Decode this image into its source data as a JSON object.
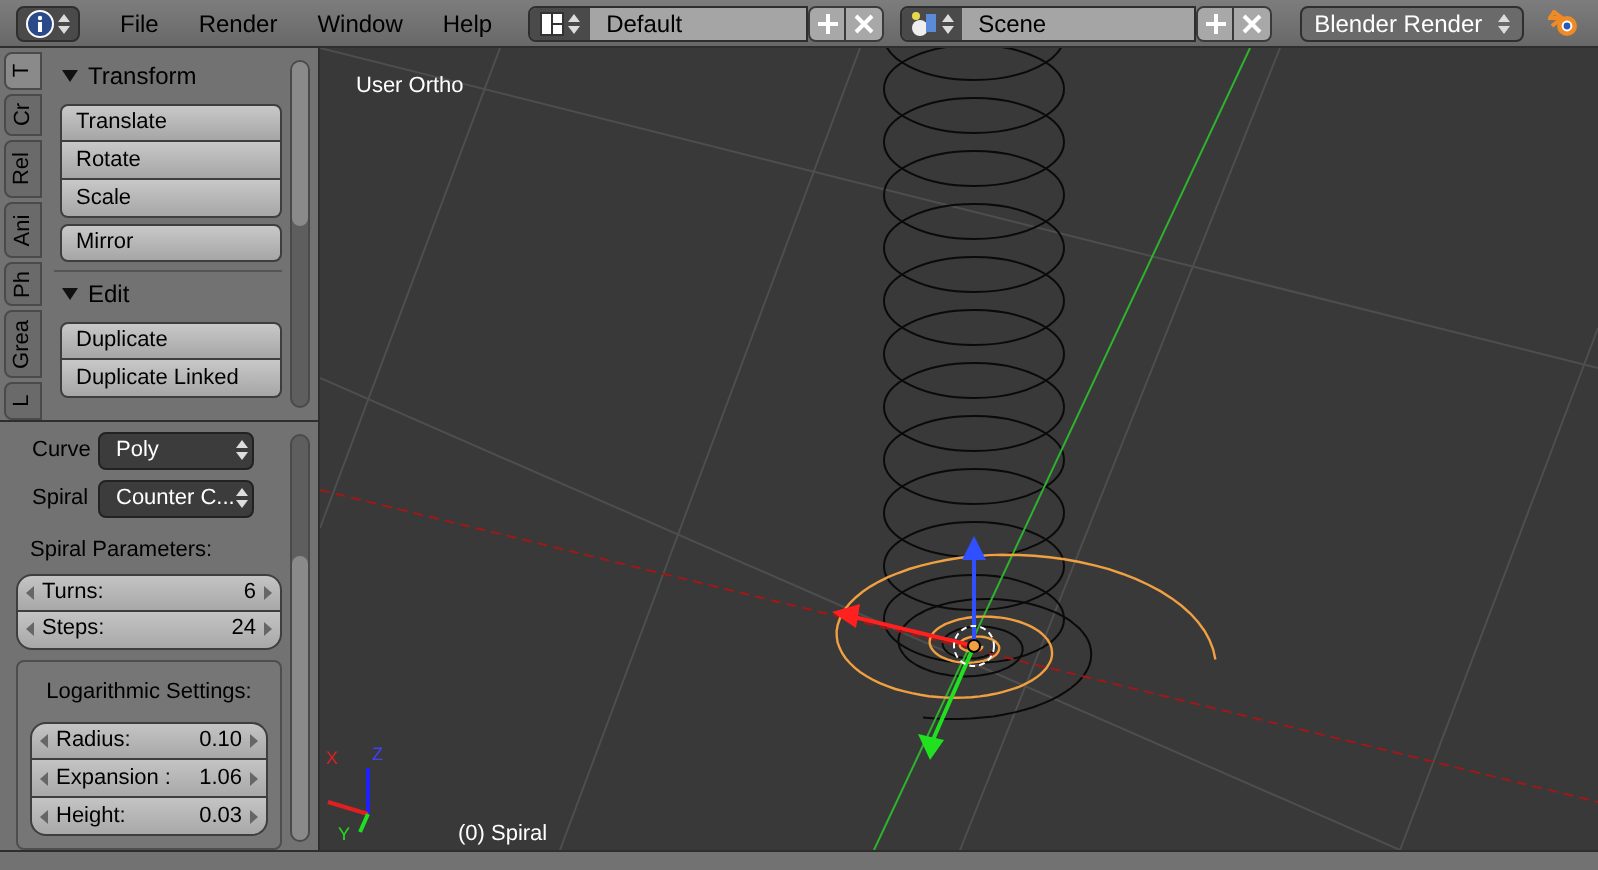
{
  "menu_bar": {
    "menus": [
      "File",
      "Render",
      "Window",
      "Help"
    ],
    "layout": "Default",
    "scene": "Scene",
    "render_engine": "Blender Render"
  },
  "tool_tabs": [
    {
      "label": "T",
      "selected": true
    },
    {
      "label": "Cr",
      "selected": false
    },
    {
      "label": "Rel",
      "selected": false
    },
    {
      "label": "Ani",
      "selected": false
    },
    {
      "label": "Ph",
      "selected": false
    },
    {
      "label": "Grea",
      "selected": false
    },
    {
      "label": "L",
      "selected": false
    }
  ],
  "tool_panels": [
    {
      "title": "Transform",
      "expanded": true,
      "button_groups": [
        [
          "Translate",
          "Rotate",
          "Scale"
        ],
        [
          "Mirror"
        ]
      ]
    },
    {
      "title": "Edit",
      "expanded": true,
      "button_groups": [
        [
          "Duplicate",
          "Duplicate Linked"
        ]
      ]
    }
  ],
  "operator_panel": {
    "selects": [
      {
        "label": "Curve",
        "value": "Poly"
      },
      {
        "label": "Spiral",
        "value": "Counter C..."
      }
    ],
    "spiral_parameters": {
      "title": "Spiral Parameters:",
      "fields": [
        {
          "label": "Turns:",
          "value": "6"
        },
        {
          "label": "Steps:",
          "value": "24"
        }
      ]
    },
    "logarithmic_settings": {
      "title": "Logarithmic Settings:",
      "fields": [
        {
          "label": "Radius:",
          "value": "0.10"
        },
        {
          "label": "Expansion :",
          "value": "1.06"
        },
        {
          "label": "Height:",
          "value": "0.03"
        }
      ]
    }
  },
  "viewport": {
    "view_name": "User Ortho",
    "object_label": "(0) Spiral",
    "axis_labels": [
      "X",
      "Y",
      "Z"
    ]
  }
}
